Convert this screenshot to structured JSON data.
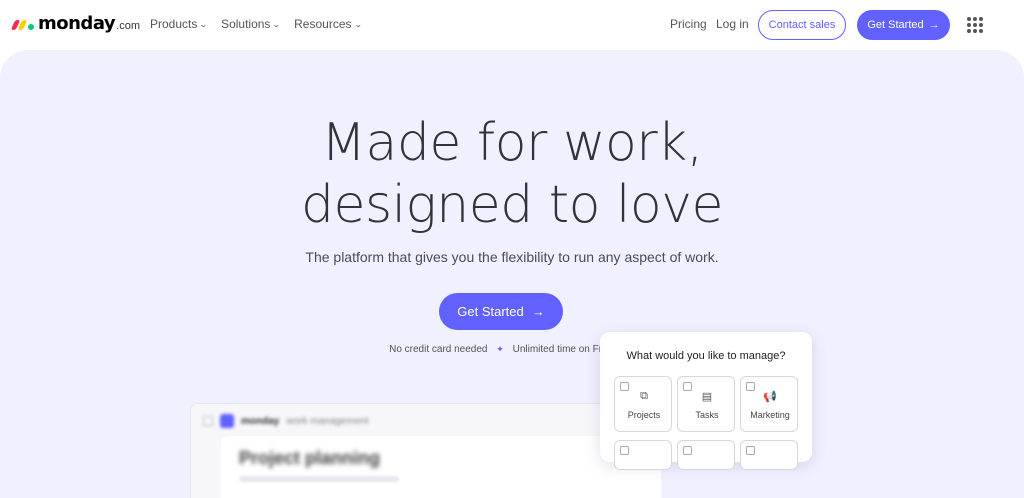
{
  "brand": {
    "name": "monday",
    "suffix": ".com"
  },
  "nav": {
    "menu": [
      {
        "label": "Products"
      },
      {
        "label": "Solutions"
      },
      {
        "label": "Resources"
      }
    ],
    "pricing": "Pricing",
    "login": "Log in",
    "contact_sales": "Contact sales",
    "get_started": "Get Started",
    "arrow": "→",
    "chevron": "⌄"
  },
  "hero": {
    "title_line1": "Made for work,",
    "title_line2": "designed to love",
    "subtitle": "The platform that gives you the flexibility to run any aspect of work.",
    "cta": "Get Started",
    "note_left": "No credit card needed",
    "note_sep": "✦",
    "note_right": "Unlimited time on Free plan"
  },
  "preview": {
    "brand": "monday",
    "brand_sub": "work management",
    "title": "Project planning"
  },
  "manage": {
    "question": "What would you like to manage?",
    "options": [
      {
        "label": "Projects",
        "icon": "projects-icon",
        "glyph": "⧉"
      },
      {
        "label": "Tasks",
        "icon": "tasks-icon",
        "glyph": "▤"
      },
      {
        "label": "Marketing",
        "icon": "megaphone-icon",
        "glyph": "📢"
      }
    ]
  },
  "colors": {
    "accent": "#6161ff",
    "hero_bg": "#f0f0ff",
    "text": "#323338"
  }
}
